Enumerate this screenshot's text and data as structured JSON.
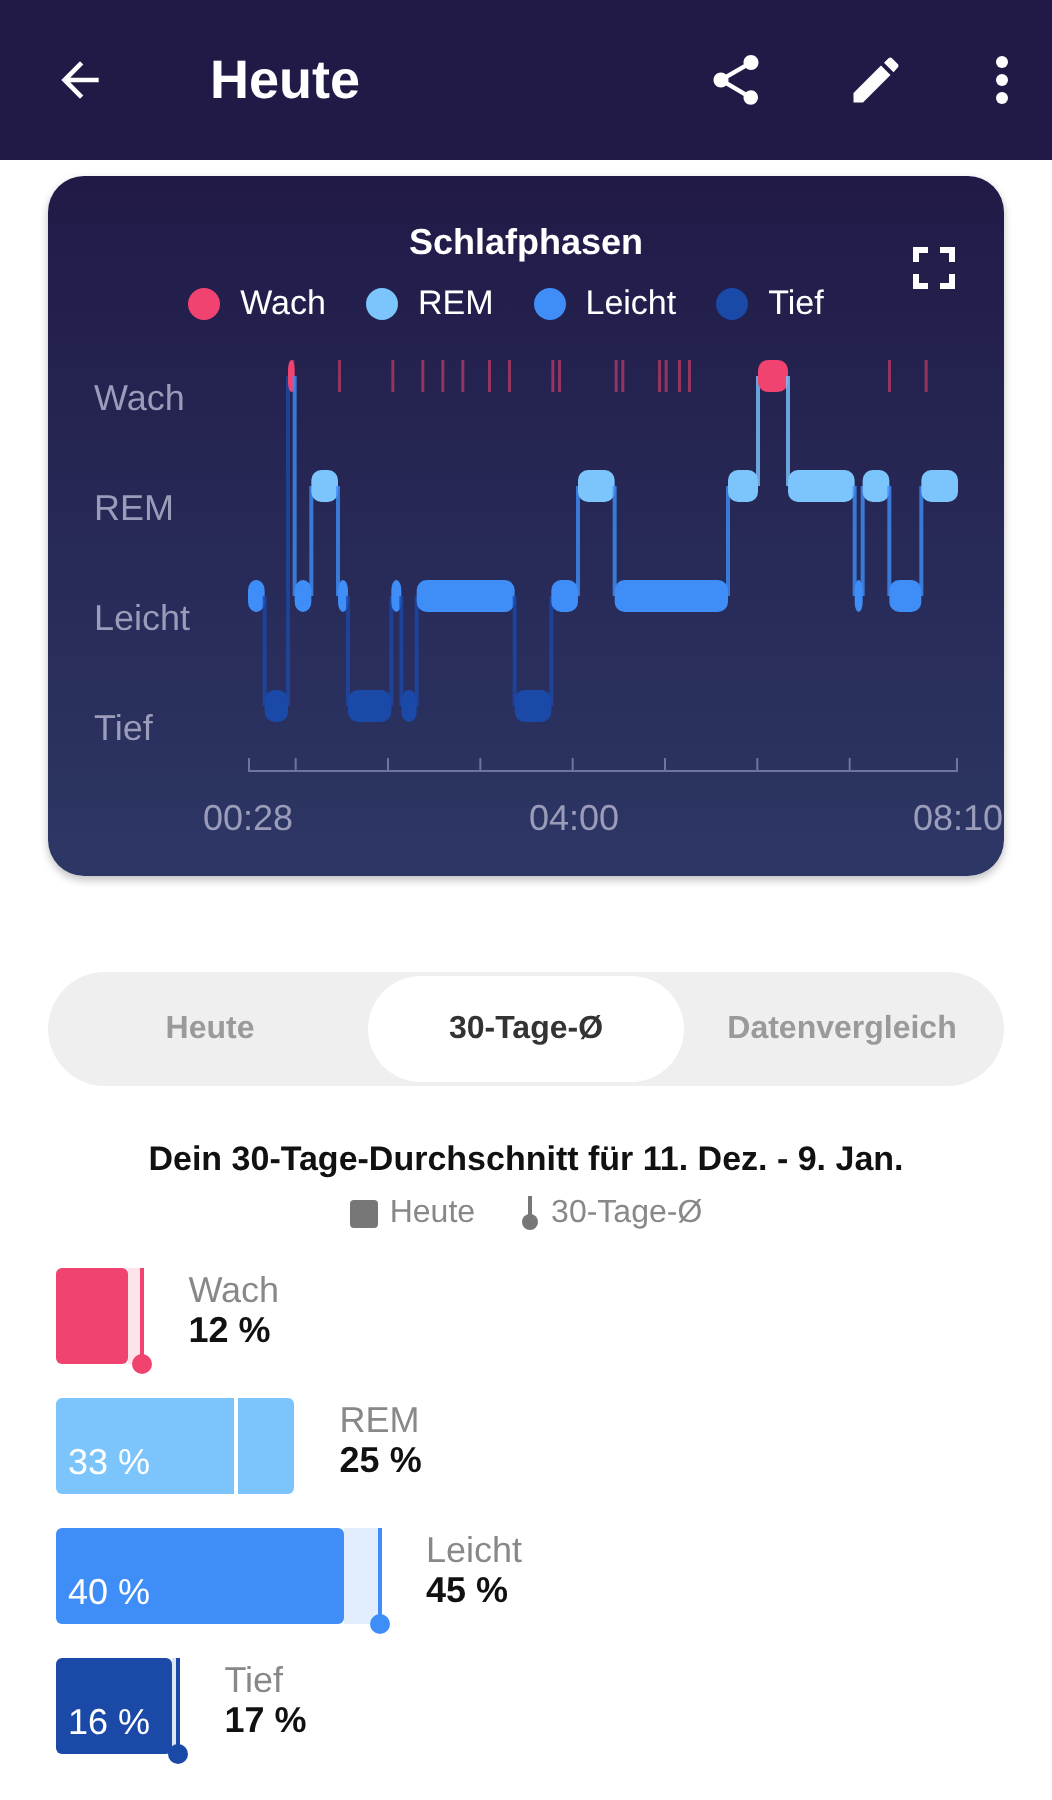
{
  "app_bar": {
    "title": "Heute"
  },
  "sleep_chart": {
    "title": "Schlafphasen",
    "legend": [
      {
        "label": "Wach",
        "color": "#f0436f"
      },
      {
        "label": "REM",
        "color": "#7cc4fc"
      },
      {
        "label": "Leicht",
        "color": "#3f8ef8"
      },
      {
        "label": "Tief",
        "color": "#1b49a8"
      }
    ],
    "y_labels": [
      "Wach",
      "REM",
      "Leicht",
      "Tief"
    ],
    "x_labels": [
      "00:28",
      "04:00",
      "08:10"
    ]
  },
  "tabs": [
    {
      "label": "Heute",
      "selected": false
    },
    {
      "label": "30-Tage-Ø",
      "selected": true
    },
    {
      "label": "Datenvergleich",
      "selected": false
    }
  ],
  "comparison": {
    "title": "Dein 30-Tage-Durchschnitt für 11. Dez. - 9. Jan.",
    "legend": [
      {
        "kind": "today",
        "label": "Heute"
      },
      {
        "kind": "average",
        "label": "30-Tage-Ø"
      }
    ],
    "stages": [
      {
        "name": "Wach",
        "color": "#f0436f",
        "average_value": "12 %"
      },
      {
        "name": "REM",
        "color": "#7cc4fc",
        "today_value": "33 %",
        "average_value": "25 %"
      },
      {
        "name": "Leicht",
        "color": "#3f8ef8",
        "today_value": "40 %",
        "average_value": "45 %"
      },
      {
        "name": "Tief",
        "color": "#1b49a8",
        "today_value": "16 %",
        "average_value": "17 %"
      }
    ]
  }
}
